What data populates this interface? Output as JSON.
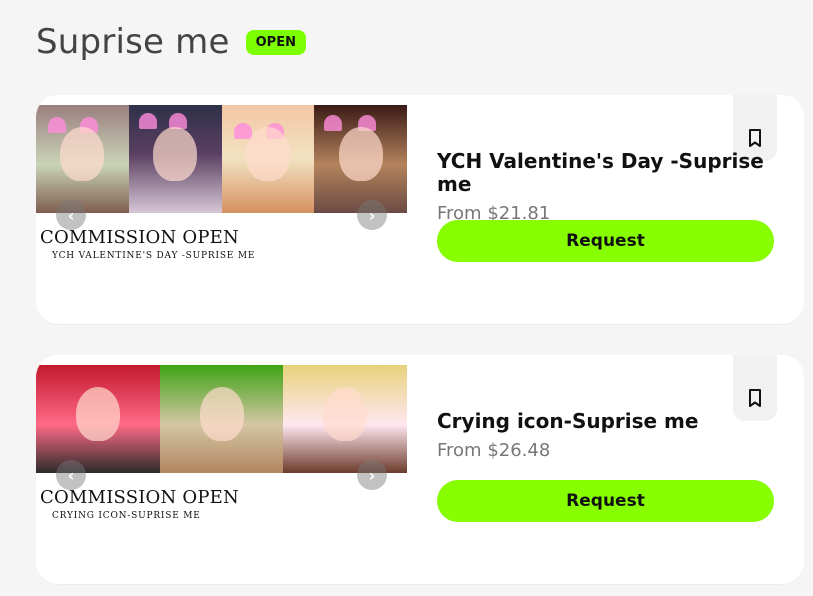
{
  "header": {
    "title": "Suprise me",
    "status_badge": "OPEN"
  },
  "cards": [
    {
      "image_text": {
        "line1": "COMMISSION OPEN",
        "line2": "YCH VALENTINE'S DAY -SUPRISE ME"
      },
      "title": "YCH Valentine's Day -Suprise me",
      "price": "From $21.81",
      "button": "Request"
    },
    {
      "image_text": {
        "line1": "COMMISSION OPEN",
        "line2": "CRYING ICON-SUPRISE ME"
      },
      "title": "Crying icon-Suprise me",
      "price": "From $26.48",
      "button": "Request"
    }
  ],
  "colors": {
    "accent": "#88FF00",
    "background": "#f5f5f5",
    "card": "#ffffff",
    "muted": "#777777"
  },
  "icons": {
    "bookmark": "bookmark-icon",
    "carousel_prev": "chevron-left-icon",
    "carousel_next": "chevron-right-icon"
  }
}
